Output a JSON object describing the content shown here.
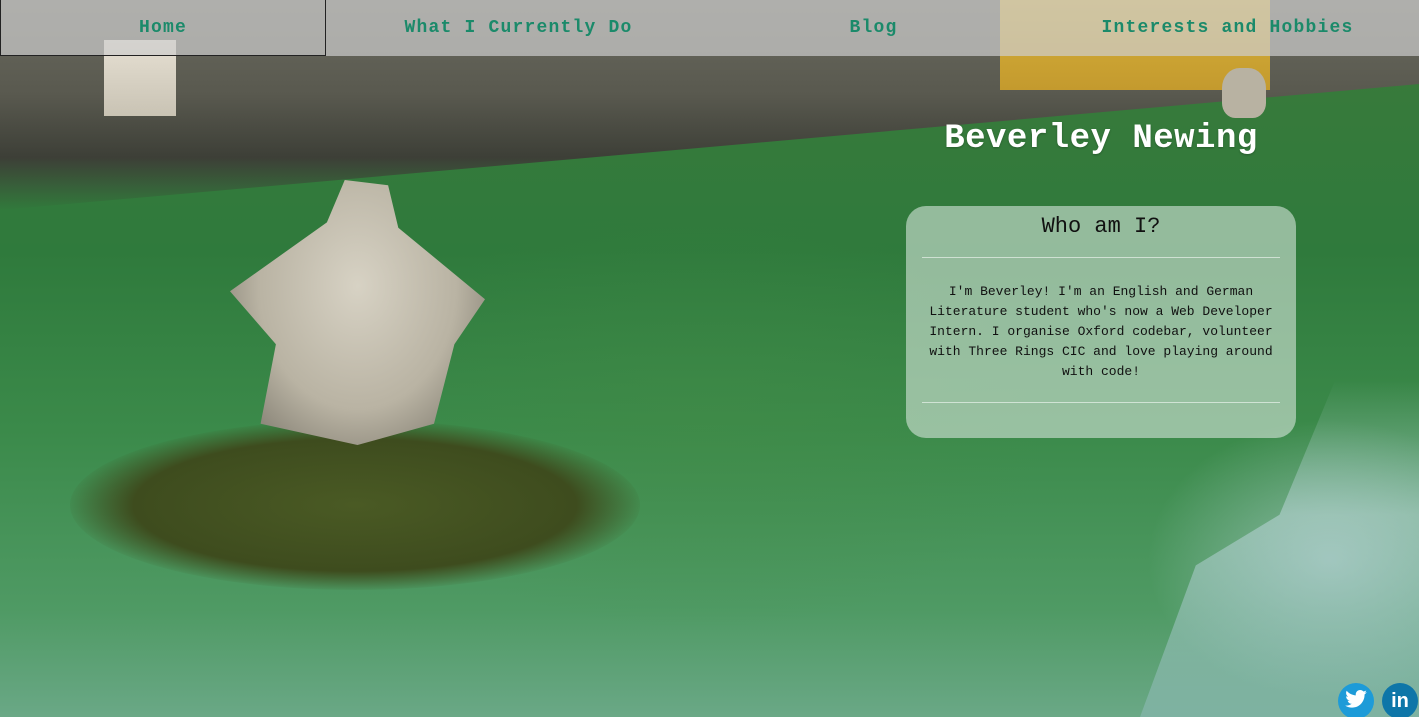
{
  "nav": {
    "items": [
      {
        "label": "Home"
      },
      {
        "label": "What I Currently Do"
      },
      {
        "label": "Blog"
      },
      {
        "label": "Interests and Hobbies"
      }
    ]
  },
  "hero": {
    "name": "Beverley Newing"
  },
  "about": {
    "heading": "Who am I?",
    "text": "I'm Beverley! I'm an English and German Literature student who's now a Web Developer Intern. I organise Oxford codebar, volunteer with Three Rings CIC and love playing around with code!"
  },
  "social": {
    "twitter_icon": "twitter-icon",
    "linkedin_icon": "linkedin-icon",
    "linkedin_glyph": "in"
  },
  "colors": {
    "nav_text": "#1b8a6a",
    "twitter": "#1d9bd8",
    "linkedin": "#0e76a8"
  }
}
